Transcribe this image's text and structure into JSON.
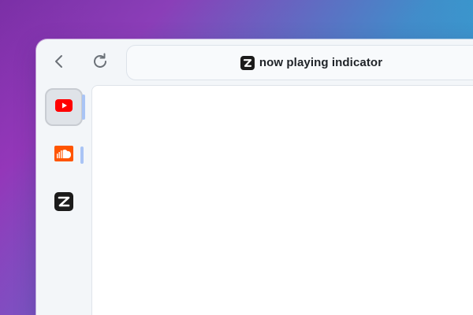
{
  "window": {
    "title": "now playing indicator"
  },
  "toolbar": {
    "back_icon": "chevron-left-icon",
    "reload_icon": "reload-icon"
  },
  "address_bar": {
    "site_icon": "zen-logo-icon",
    "title": "now playing indicator"
  },
  "sidebar": {
    "tabs": [
      {
        "icon": "youtube-icon",
        "active": true,
        "playing_indicator": true
      },
      {
        "icon": "soundcloud-icon",
        "active": false,
        "playing_indicator": true
      },
      {
        "icon": "zen-logo-icon",
        "active": false,
        "playing_indicator": false
      }
    ]
  },
  "colors": {
    "indicator": "#a9c4f5",
    "youtube_red": "#ff0000",
    "soundcloud_orange": "#ff5500",
    "gradient_start": "#7b2fa6",
    "gradient_end": "#17c6dc"
  }
}
